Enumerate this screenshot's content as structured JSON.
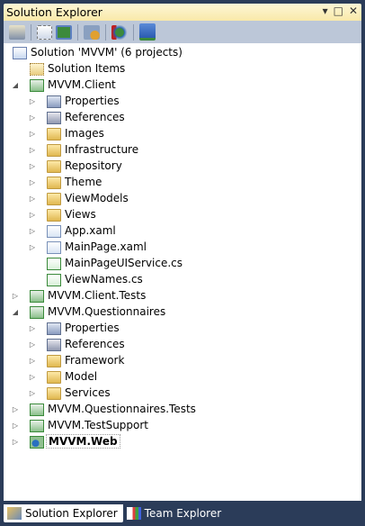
{
  "panel": {
    "title": "Solution Explorer",
    "dropdown_icon": "▾",
    "maximize_icon": "□",
    "close_icon": "✕"
  },
  "toolbar": [
    {
      "name": "properties-icon"
    },
    {
      "name": "show-all-files-icon"
    },
    {
      "name": "refresh-icon"
    },
    {
      "name": "class-diagram-icon"
    },
    {
      "name": "aspnet-configuration-icon"
    },
    {
      "name": "copy-website-icon"
    }
  ],
  "tree": [
    {
      "label": "Solution 'MVVM' (6 projects)",
      "level": 0,
      "expander": "none",
      "icon": "solution"
    },
    {
      "label": "Solution Items",
      "level": 1,
      "expander": "none",
      "icon": "folder-dotted"
    },
    {
      "label": "MVVM.Client",
      "level": 1,
      "expander": "expanded",
      "icon": "csproj"
    },
    {
      "label": "Properties",
      "level": 2,
      "expander": "collapsed",
      "icon": "properties"
    },
    {
      "label": "References",
      "level": 2,
      "expander": "collapsed",
      "icon": "references"
    },
    {
      "label": "Images",
      "level": 2,
      "expander": "collapsed",
      "icon": "folder"
    },
    {
      "label": "Infrastructure",
      "level": 2,
      "expander": "collapsed",
      "icon": "folder"
    },
    {
      "label": "Repository",
      "level": 2,
      "expander": "collapsed",
      "icon": "folder"
    },
    {
      "label": "Theme",
      "level": 2,
      "expander": "collapsed",
      "icon": "folder"
    },
    {
      "label": "ViewModels",
      "level": 2,
      "expander": "collapsed",
      "icon": "folder"
    },
    {
      "label": "Views",
      "level": 2,
      "expander": "collapsed",
      "icon": "folder"
    },
    {
      "label": "App.xaml",
      "level": 2,
      "expander": "collapsed",
      "icon": "xaml"
    },
    {
      "label": "MainPage.xaml",
      "level": 2,
      "expander": "collapsed",
      "icon": "xaml"
    },
    {
      "label": "MainPageUIService.cs",
      "level": 2,
      "expander": "none",
      "icon": "cs"
    },
    {
      "label": "ViewNames.cs",
      "level": 2,
      "expander": "none",
      "icon": "cs"
    },
    {
      "label": "MVVM.Client.Tests",
      "level": 1,
      "expander": "collapsed",
      "icon": "csproj"
    },
    {
      "label": "MVVM.Questionnaires",
      "level": 1,
      "expander": "expanded",
      "icon": "csproj"
    },
    {
      "label": "Properties",
      "level": 2,
      "expander": "collapsed",
      "icon": "properties"
    },
    {
      "label": "References",
      "level": 2,
      "expander": "collapsed",
      "icon": "references"
    },
    {
      "label": "Framework",
      "level": 2,
      "expander": "collapsed",
      "icon": "folder"
    },
    {
      "label": "Model",
      "level": 2,
      "expander": "collapsed",
      "icon": "folder"
    },
    {
      "label": "Services",
      "level": 2,
      "expander": "collapsed",
      "icon": "folder"
    },
    {
      "label": "MVVM.Questionnaires.Tests",
      "level": 1,
      "expander": "collapsed",
      "icon": "csproj"
    },
    {
      "label": "MVVM.TestSupport",
      "level": 1,
      "expander": "collapsed",
      "icon": "csproj"
    },
    {
      "label": "MVVM.Web",
      "level": 1,
      "expander": "collapsed",
      "icon": "webproj",
      "bold": true
    }
  ],
  "tabs": [
    {
      "label": "Solution Explorer",
      "active": true
    },
    {
      "label": "Team Explorer",
      "active": false
    }
  ]
}
